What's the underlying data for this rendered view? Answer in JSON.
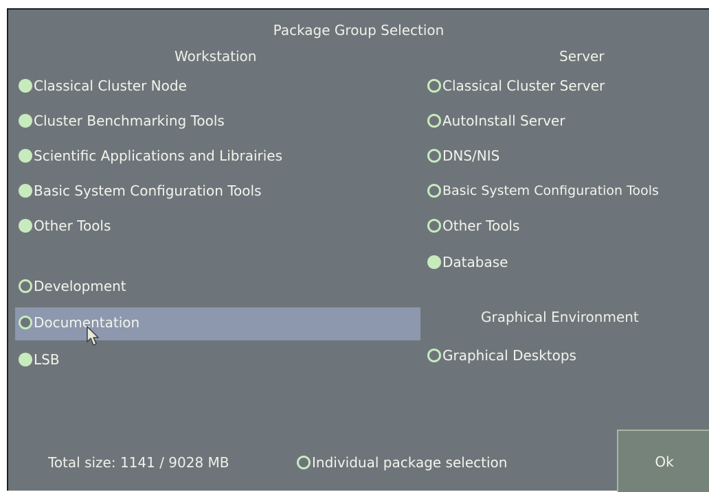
{
  "title": "Package Group Selection",
  "workstation": {
    "heading": "Workstation",
    "groups": [
      {
        "label": "Classical Cluster Node",
        "state": "selected"
      },
      {
        "label": "Cluster Benchmarking Tools",
        "state": "selected"
      },
      {
        "label": "Scientific Applications and Librairies",
        "state": "selected"
      },
      {
        "label": "Basic System Configuration Tools",
        "state": "selected"
      },
      {
        "label": "Other Tools",
        "state": "selected"
      },
      {
        "label": "Development",
        "state": "unselected"
      },
      {
        "label": "Documentation",
        "state": "unselected",
        "focused": true
      },
      {
        "label": "LSB",
        "state": "selected"
      }
    ]
  },
  "server": {
    "heading": "Server",
    "groups": [
      {
        "label": "Classical Cluster Server",
        "state": "unselected"
      },
      {
        "label": "AutoInstall Server",
        "state": "unselected"
      },
      {
        "label": "DNS/NIS",
        "state": "unselected"
      },
      {
        "label": "Basic System Configuration Tools",
        "state": "unselected"
      },
      {
        "label": "Other Tools",
        "state": "unselected"
      },
      {
        "label": "Database",
        "state": "selected"
      }
    ]
  },
  "graphical": {
    "heading": "Graphical Environment",
    "groups": [
      {
        "label": "Graphical Desktops",
        "state": "unselected"
      }
    ]
  },
  "footer": {
    "total_size": "Total size: 1141 / 9028 MB",
    "individual_selection": {
      "label": "Individual package selection",
      "state": "unselected"
    },
    "ok_label": "Ok"
  },
  "colors": {
    "background": "#6e757a",
    "radio": "#c8ebbe",
    "highlight": "#8d97ad",
    "text": "#f2f5ec"
  }
}
